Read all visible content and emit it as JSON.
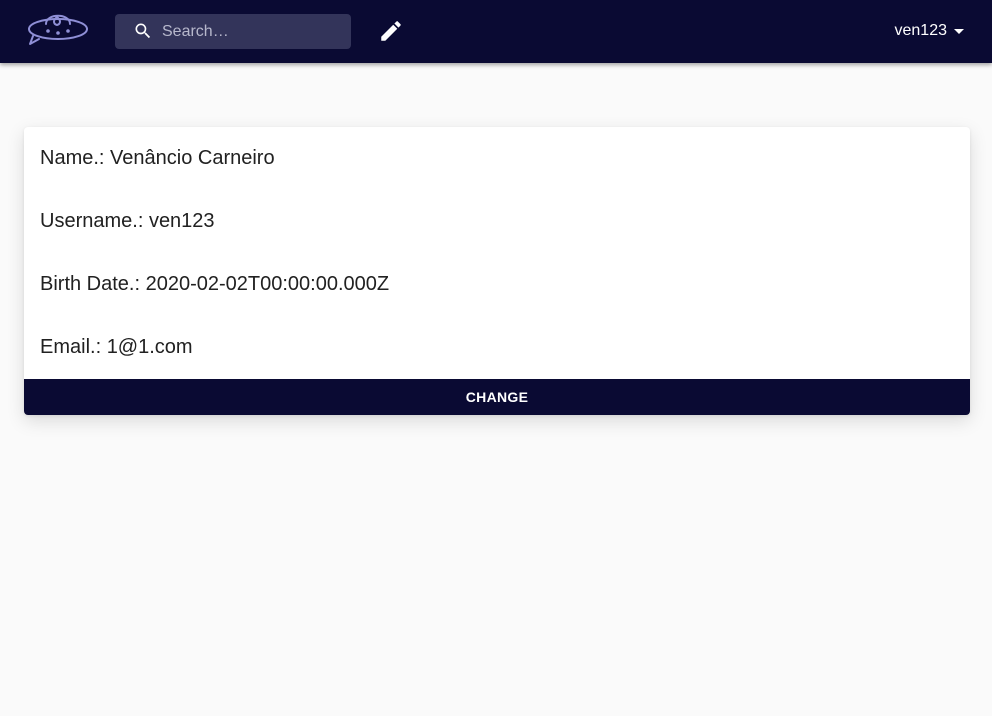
{
  "header": {
    "logo_icon": "ufo-chat-icon",
    "search": {
      "placeholder": "Search…",
      "value": "",
      "icon": "search-icon"
    },
    "edit_icon": "pencil-icon",
    "user_menu": {
      "label": "ven123",
      "icon": "caret-down-icon"
    }
  },
  "profile": {
    "name_label": "Name.:",
    "name_value": "Venâncio Carneiro",
    "username_label": "Username.:",
    "username_value": "ven123",
    "birth_label": "Birth Date.:",
    "birth_value": "2020-02-02T00:00:00.000Z",
    "email_label": "Email.:",
    "email_value": "1@1.com",
    "change_label": "CHANGE"
  },
  "colors": {
    "appbar": "#0a0a33",
    "search_bg": "#33345a",
    "logo_stroke": "#8f8fd6",
    "page_bg": "#fafafa",
    "button_bg": "#0a0a33"
  }
}
